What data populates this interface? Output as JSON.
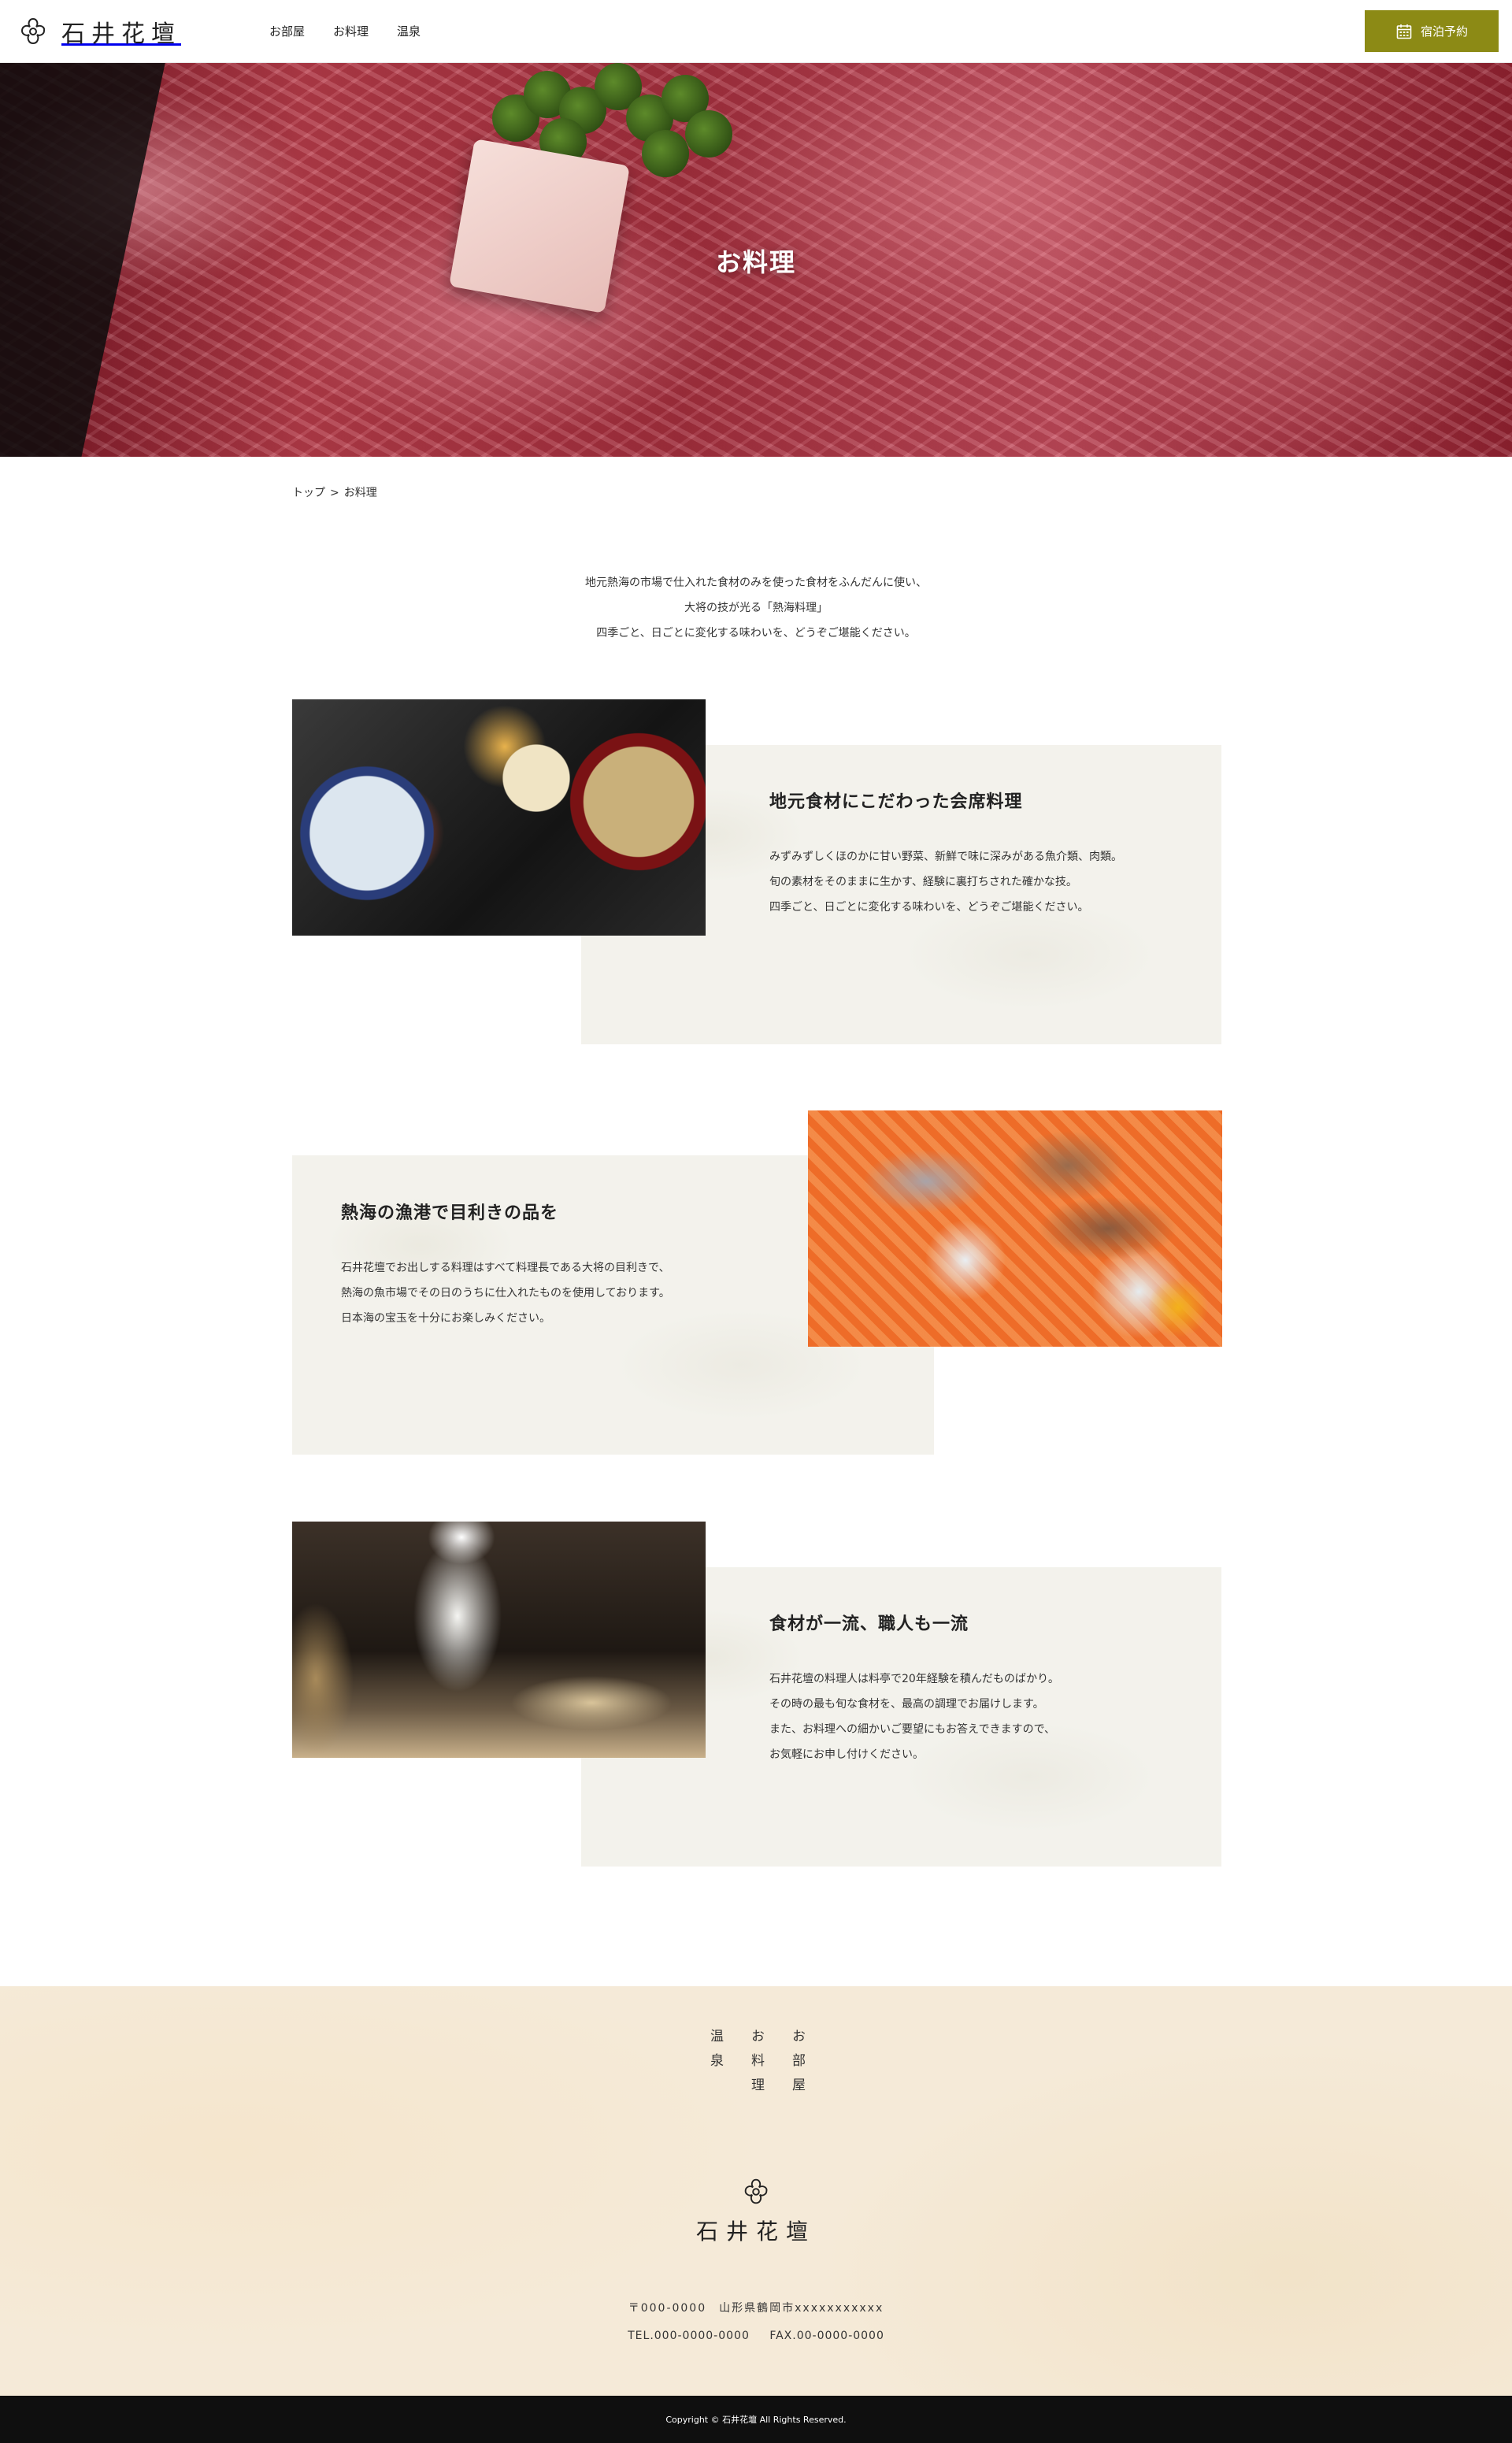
{
  "header": {
    "site_name": "石井花壇",
    "nav": [
      {
        "label": "お部屋"
      },
      {
        "label": "お料理"
      },
      {
        "label": "温泉"
      }
    ],
    "reserve_label": "宿泊予約",
    "reserve_icon": "calendar-icon",
    "accent_color": "#8c8a15"
  },
  "hero": {
    "title": "お料理"
  },
  "breadcrumb": {
    "home": "トップ",
    "separator": ">",
    "current": "お料理"
  },
  "intro": {
    "lines": [
      "地元熱海の市場で仕入れた食材のみを使った食材をふんだんに使い、",
      "大将の技が光る「熱海料理」",
      "四季ごと、日ごとに変化する味わいを、どうぞご堪能ください。"
    ]
  },
  "features": [
    {
      "title": "地元食材にこだわった会席料理",
      "lines": [
        "みずみずしくほのかに甘い野菜、新鮮で味に深みがある魚介類、肉類。",
        "旬の素材をそのままに生かす、経験に裏打ちされた確かな技。",
        "四季ごと、日ごとに変化する味わいを、どうぞご堪能ください。"
      ]
    },
    {
      "title": "熱海の漁港で目利きの品を",
      "lines": [
        "石井花壇でお出しする料理はすべて料理長である大将の目利きで、",
        "熱海の魚市場でその日のうちに仕入れたものを使用しております。",
        "日本海の宝玉を十分にお楽しみください。"
      ]
    },
    {
      "title": "食材が一流、職人も一流",
      "lines": [
        "石井花壇の料理人は料亭で20年経験を積んだものばかり。",
        "その時の最も旬な食材を、最高の調理でお届けします。",
        "また、お料理への細かいご要望にもお答えできますので、",
        "お気軽にお申し付けください。"
      ]
    }
  ],
  "footer": {
    "nav": [
      {
        "label": "温泉"
      },
      {
        "label": "お料理"
      },
      {
        "label": "お部屋"
      }
    ],
    "site_name": "石井花壇",
    "address": "〒000-0000　山形県鶴岡市xxxxxxxxxxx",
    "tel": "TEL.000-0000-0000",
    "fax": "FAX.00-0000-0000",
    "copyright": "Copyright © 石井花壇 All Rights Reserved."
  }
}
